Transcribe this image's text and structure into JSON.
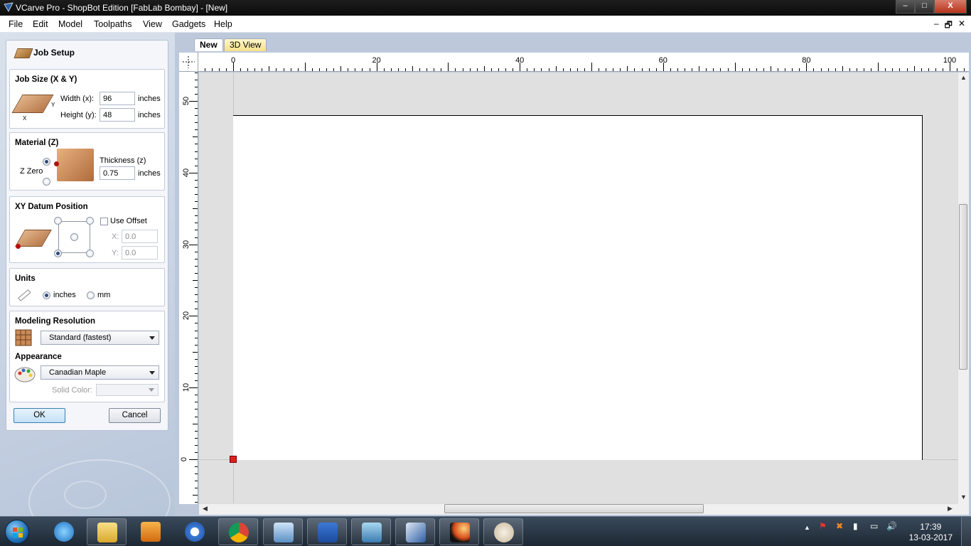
{
  "window": {
    "title": "VCarve Pro - ShopBot Edition [FabLab Bombay] - [New]",
    "minimize": "–",
    "maximize": "□",
    "close": "X"
  },
  "menu": [
    "File",
    "Edit",
    "Model",
    "Toolpaths",
    "View",
    "Gadgets",
    "Help"
  ],
  "mdi_controls": [
    "–",
    "🗗",
    "✕"
  ],
  "job_setup": {
    "title": "Job Setup",
    "job_size": {
      "heading": "Job Size (X & Y)",
      "width_label": "Width (x):",
      "width_value": "96",
      "height_label": "Height (y):",
      "height_value": "48",
      "unit": "inches",
      "x_axis": "X",
      "y_axis": "Y"
    },
    "material": {
      "heading": "Material (Z)",
      "z_zero_label": "Z Zero",
      "thickness_label": "Thickness (z)",
      "thickness_value": "0.75",
      "unit": "inches"
    },
    "xy_datum": {
      "heading": "XY Datum Position",
      "use_offset_label": "Use Offset",
      "x_label": "X:",
      "x_value": "0.0",
      "y_label": "Y:",
      "y_value": "0.0"
    },
    "units": {
      "heading": "Units",
      "inches_label": "inches",
      "mm_label": "mm",
      "selected": "inches"
    },
    "modeling_resolution": {
      "heading": "Modeling Resolution",
      "value": "Standard (fastest)"
    },
    "appearance": {
      "heading": "Appearance",
      "value": "Canadian Maple",
      "solid_color_label": "Solid Color:"
    },
    "ok_label": "OK",
    "cancel_label": "Cancel"
  },
  "tabs": [
    {
      "label": "New",
      "active": true
    },
    {
      "label": "3D View",
      "active": false
    }
  ],
  "ruler": {
    "horizontal_labels": [
      "0",
      "20",
      "40",
      "60",
      "80",
      "100"
    ],
    "vertical_labels": [
      "50",
      "40",
      "30",
      "20",
      "10",
      "0"
    ]
  },
  "taskbar": {
    "apps": [
      "internet-explorer",
      "file-explorer",
      "media-player",
      "browser",
      "chrome",
      "remote-desktop",
      "word",
      "photos",
      "vcarve",
      "app-launcher",
      "paint"
    ],
    "clock_time": "17:39",
    "clock_date": "13-03-2017"
  },
  "colors": {
    "accent": "#3c7fb1",
    "origin_marker": "#e21d1d",
    "canvas_bg": "#e0e0e0",
    "material": "#c98a56"
  }
}
